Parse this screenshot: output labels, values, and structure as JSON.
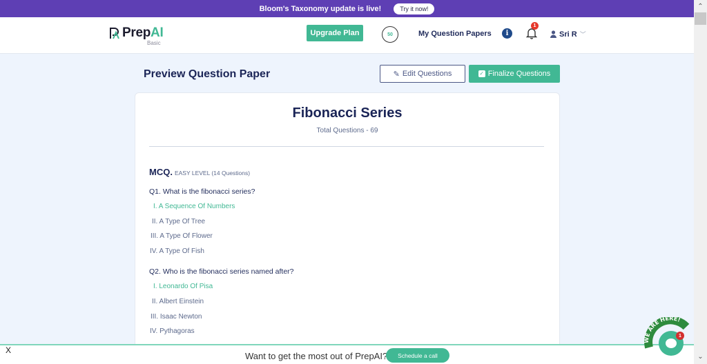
{
  "announcement": {
    "text": "Bloom's Taxonomy update is live!",
    "button": "Try it now!"
  },
  "header": {
    "logo_prefix": "Prep",
    "logo_suffix": "AI",
    "plan": "Basic",
    "upgrade_label": "Upgrade Plan",
    "credits": "50",
    "nav_papers": "My Question Papers",
    "info_icon": "i",
    "notification_count": "1",
    "user_name": "Sri R",
    "user_chevron": "﹀"
  },
  "toolbar": {
    "title": "Preview Question Paper",
    "edit_label": "Edit Questions",
    "finalize_label": "Finalize Questions",
    "edit_icon": "✎",
    "check_icon": "✓"
  },
  "paper": {
    "title": "Fibonacci Series",
    "total": "Total Questions - 69",
    "section": {
      "type": "MCQ.",
      "level": "EASY LEVEL (14 Questions)"
    },
    "questions": [
      {
        "text": "Q1. What is the fibonacci series?",
        "options": [
          {
            "label": "I. A Sequence Of Numbers",
            "correct": true
          },
          {
            "label": "II. A Type Of Tree",
            "correct": false
          },
          {
            "label": "III. A Type Of Flower",
            "correct": false
          },
          {
            "label": "IV. A Type Of Fish",
            "correct": false
          }
        ]
      },
      {
        "text": "Q2. Who is the fibonacci series named after?",
        "options": [
          {
            "label": "I. Leonardo Of Pisa",
            "correct": true
          },
          {
            "label": "II. Albert Einstein",
            "correct": false
          },
          {
            "label": "III. Isaac Newton",
            "correct": false
          },
          {
            "label": "IV. Pythagoras",
            "correct": false
          }
        ]
      }
    ]
  },
  "bottom_bar": {
    "close": "X",
    "text": "Want to get the most out of PrepAI?",
    "button": "Schedule a call"
  },
  "chat": {
    "banner": "WE ARE HERE!",
    "badge": "1"
  },
  "scrollbar": {
    "up": "⌃",
    "down": "⌄"
  },
  "colors": {
    "brand": "#41b894",
    "announce_bg": "#5e3fb4",
    "navy": "#1a2456",
    "badge_red": "#e6382b"
  }
}
